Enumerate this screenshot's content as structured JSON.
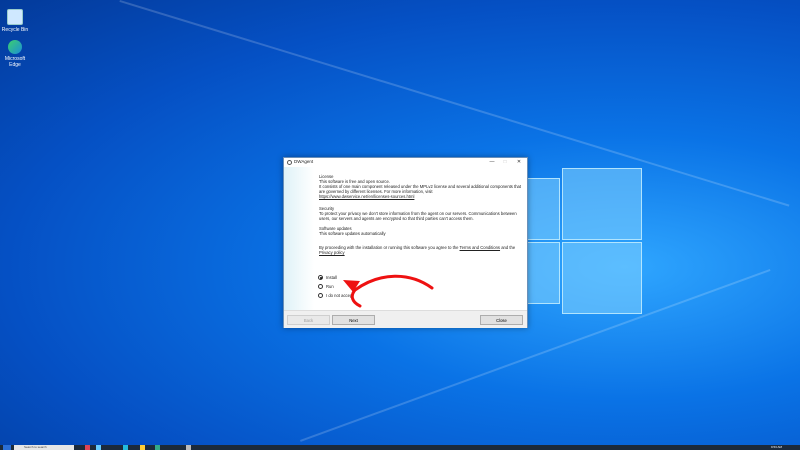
{
  "desktop": {
    "icons": [
      {
        "label": "Recycle Bin",
        "icon": "recycle-bin-icon"
      },
      {
        "label": "Microsoft Edge",
        "icon": "edge-icon"
      }
    ]
  },
  "dialog": {
    "title": "DWAgent",
    "controls": {
      "minimize": "—",
      "maximize": "□",
      "close": "✕"
    },
    "license_heading": "License",
    "license_line1": "This software is free and open source.",
    "license_line2": "It consists of one main component released under the MPLv2 license and several additional components that are governed by different licenses. For more information, visit",
    "license_link": "https://www.dwservice.net/en/licenses-sources.html",
    "security_heading": "Security",
    "security_text": "To protect your privacy we don't store information from the agent on our servers. Communications between users, our servers and agents are encrypted so that third parties can't access them.",
    "updates_heading": "Software updates",
    "updates_text": "This software updates automatically",
    "agree_prefix": "By proceeding with the installation or running this software you agree to the",
    "terms_link": "Terms and Conditions",
    "agree_and": "and the",
    "privacy_link": "Privacy policy",
    "options": [
      {
        "label": "Install",
        "selected": true
      },
      {
        "label": "Run",
        "selected": false
      },
      {
        "label": "I do not accept",
        "selected": false
      }
    ],
    "buttons": {
      "back": "Back",
      "next": "Next",
      "close": "Close"
    }
  },
  "taskbar": {
    "search_placeholder": "Search to search",
    "clock": "9:53 AM"
  }
}
